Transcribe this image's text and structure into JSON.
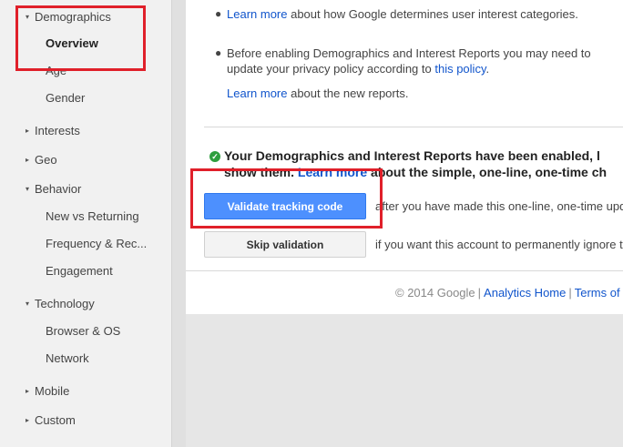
{
  "sidebar": {
    "items": [
      {
        "label": "Demographics",
        "arrow": "▾",
        "level": 0
      },
      {
        "label": "Overview",
        "level": 1,
        "active": true
      },
      {
        "label": "Age",
        "level": 1
      },
      {
        "label": "Gender",
        "level": 1
      },
      {
        "label": "Interests",
        "arrow": "▸",
        "level": 0
      },
      {
        "label": "Geo",
        "arrow": "▸",
        "level": 0
      },
      {
        "label": "Behavior",
        "arrow": "▾",
        "level": 0
      },
      {
        "label": "New vs Returning",
        "level": 1
      },
      {
        "label": "Frequency & Rec...",
        "level": 1
      },
      {
        "label": "Engagement",
        "level": 1
      },
      {
        "label": "Technology",
        "arrow": "▾",
        "level": 0
      },
      {
        "label": "Browser & OS",
        "level": 1
      },
      {
        "label": "Network",
        "level": 1
      },
      {
        "label": "Mobile",
        "arrow": "▸",
        "level": 0
      },
      {
        "label": "Custom",
        "arrow": "▸",
        "level": 0
      }
    ]
  },
  "info": {
    "bullet1_link": "Learn more",
    "bullet1_text": " about how Google determines user interest categories.",
    "bullet2_text": "Before enabling Demographics and Interest Reports you may need to update your privacy policy according to ",
    "bullet2_link": "this policy",
    "bullet2_end": ".",
    "learn_more_link": "Learn more",
    "learn_more_text": " about the new reports."
  },
  "status": {
    "enabled_text": "Your Demographics and Interest Reports have been enabled, l",
    "line2_start": "show them. ",
    "line2_link": "Learn more",
    "line2_end": " about the simple, one-line, one-time ch"
  },
  "actions": {
    "validate_label": "Validate tracking code",
    "validate_note": "after you have made this one-line, one-time upd",
    "skip_label": "Skip validation",
    "skip_note": "if you want this account to permanently ignore t"
  },
  "footer": {
    "copyright": "© 2014 Google",
    "sep": "|",
    "analytics_home": "Analytics Home",
    "terms": "Terms of"
  },
  "colors": {
    "link": "#1155cc",
    "primary_button": "#4d90fe",
    "highlight": "#e0202a",
    "check": "#2e9e3e"
  }
}
